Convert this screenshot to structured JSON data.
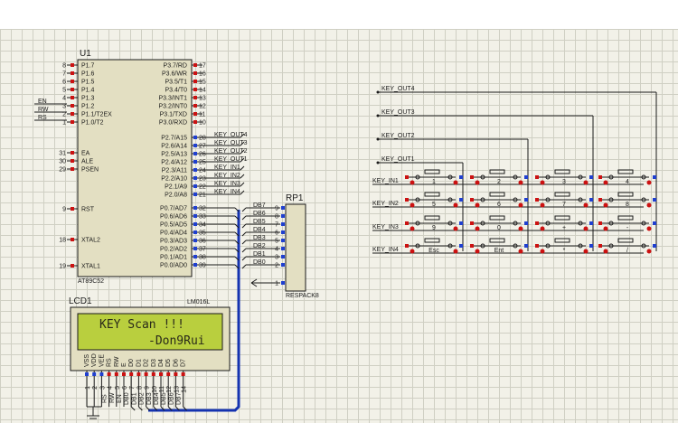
{
  "u1": {
    "ref": "U1",
    "part": "AT89C52",
    "pins_left_top": [
      {
        "num": "8",
        "name": "P1.7"
      },
      {
        "num": "7",
        "name": "P1.6"
      },
      {
        "num": "6",
        "name": "P1.5"
      },
      {
        "num": "5",
        "name": "P1.4"
      },
      {
        "num": "4",
        "name": "P1.3"
      },
      {
        "num": "3",
        "name": "P1.2"
      },
      {
        "num": "2",
        "name": "P1.1/T2EX"
      },
      {
        "num": "1",
        "name": "P1.0/T2"
      }
    ],
    "pins_left_ctrl": [
      {
        "num": "31",
        "name": "EA"
      },
      {
        "num": "30",
        "name": "ALE"
      },
      {
        "num": "29",
        "name": "PSEN"
      }
    ],
    "pin_rst": {
      "num": "9",
      "name": "RST"
    },
    "pin_xtal2": {
      "num": "18",
      "name": "XTAL2"
    },
    "pin_xtal1": {
      "num": "19",
      "name": "XTAL1"
    },
    "pins_right_p3": [
      {
        "num": "17",
        "name": "P3.7/RD"
      },
      {
        "num": "16",
        "name": "P3.6/WR"
      },
      {
        "num": "15",
        "name": "P3.5/T1"
      },
      {
        "num": "14",
        "name": "P3.4/T0"
      },
      {
        "num": "13",
        "name": "P3.3/INT1"
      },
      {
        "num": "12",
        "name": "P3.2/INT0"
      },
      {
        "num": "11",
        "name": "P3.1/TXD"
      },
      {
        "num": "10",
        "name": "P3.0/RXD"
      }
    ],
    "pins_right_p2": [
      {
        "num": "28",
        "name": "P2.7/A15",
        "net": "KEY_OUT4"
      },
      {
        "num": "27",
        "name": "P2.6/A14",
        "net": "KEY_OUT3"
      },
      {
        "num": "26",
        "name": "P2.5/A13",
        "net": "KEY_OUT2"
      },
      {
        "num": "25",
        "name": "P2.4/A12",
        "net": "KEY_OUT1"
      },
      {
        "num": "24",
        "name": "P2.3/A11",
        "net": "KEY_IN1"
      },
      {
        "num": "23",
        "name": "P2.2/A10",
        "net": "KEY_IN2"
      },
      {
        "num": "22",
        "name": "P2.1/A9",
        "net": "KEY_IN3"
      },
      {
        "num": "21",
        "name": "P2.0/A8",
        "net": "KEY_IN4"
      }
    ],
    "pins_right_p0": [
      {
        "num": "32",
        "name": "P0.7/AD7",
        "net": "DB7"
      },
      {
        "num": "33",
        "name": "P0.6/AD6",
        "net": "DB6"
      },
      {
        "num": "34",
        "name": "P0.5/AD5",
        "net": "DB5"
      },
      {
        "num": "35",
        "name": "P0.4/AD4",
        "net": "DB4"
      },
      {
        "num": "36",
        "name": "P0.3/AD3",
        "net": "DB3"
      },
      {
        "num": "37",
        "name": "P0.2/AD2",
        "net": "DB2"
      },
      {
        "num": "38",
        "name": "P0.1/AD1",
        "net": "DB1"
      },
      {
        "num": "39",
        "name": "P0.0/AD0",
        "net": "DB0"
      }
    ],
    "ctrl_nets": [
      "EN",
      "RW",
      "RS"
    ]
  },
  "rp1": {
    "ref": "RP1",
    "part": "RESPACK8",
    "pins": [
      "9",
      "8",
      "7",
      "6",
      "5",
      "4",
      "3",
      "2",
      "1"
    ]
  },
  "lcd": {
    "ref": "LCD1",
    "part": "LM016L",
    "line1": "KEY Scan !!!",
    "line2": "-Don9Rui",
    "pin_names": [
      "VSS",
      "VDD",
      "VEE",
      "RS",
      "RW",
      "E",
      "D0",
      "D1",
      "D2",
      "D3",
      "D4",
      "D5",
      "D6",
      "D7"
    ],
    "pin_nums": [
      "1",
      "2",
      "3",
      "4",
      "5",
      "6",
      "7",
      "8",
      "9",
      "10",
      "11",
      "12",
      "13",
      "14"
    ],
    "bus_labels_left": [
      "RS",
      "RW",
      "EN"
    ],
    "bus_labels_data": [
      "DB0",
      "DB1",
      "DB2",
      "DB3",
      "DB4",
      "DB5",
      "DB6",
      "DB7"
    ]
  },
  "keypad": {
    "out_labels": [
      "KEY_OUT4",
      "KEY_OUT3",
      "KEY_OUT2",
      "KEY_OUT1"
    ],
    "in_labels": [
      "KEY_IN1",
      "KEY_IN2",
      "KEY_IN3",
      "KEY_IN4"
    ],
    "keys": [
      [
        "1",
        "2",
        "3",
        "4"
      ],
      [
        "5",
        "6",
        "7",
        "8"
      ],
      [
        "9",
        "0",
        "+",
        "-"
      ],
      [
        "Esc",
        "Ent",
        "*",
        "/"
      ]
    ]
  },
  "colors": {
    "wire": "#1a1a1a",
    "pin_red": "#cc1111",
    "pin_blue": "#1f3fd0",
    "bus": "#1533b0",
    "component_fill": "#e3dfc2",
    "lcd_screen": "#b9cf3e",
    "lcd_text": "#2a2a1a"
  }
}
